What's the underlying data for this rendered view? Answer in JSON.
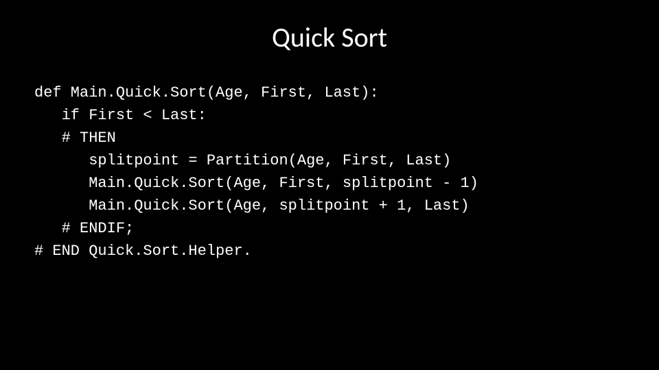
{
  "title": "Quick Sort",
  "code": {
    "l0": "def Main.Quick.Sort(Age, First, Last):",
    "l1": "   if First < Last:",
    "l2": "   # THEN",
    "l3": "      splitpoint = Partition(Age, First, Last)",
    "l4": "      Main.Quick.Sort(Age, First, splitpoint - 1)",
    "l5": "      Main.Quick.Sort(Age, splitpoint + 1, Last)",
    "l6": "   # ENDIF;",
    "l7": "# END Quick.Sort.Helper."
  }
}
